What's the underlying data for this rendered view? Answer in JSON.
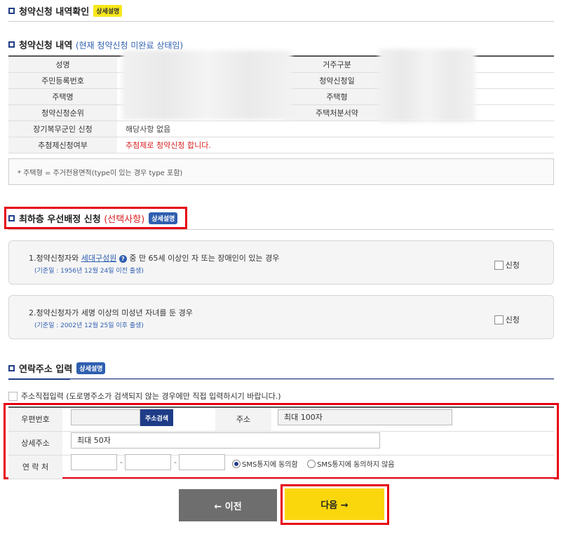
{
  "section1": {
    "title": "청약신청 내역확인",
    "badge": "상세설명"
  },
  "section2": {
    "title": "청약신청 내역",
    "sub": "(현재 청약신청 미완료 상태임)"
  },
  "info_table": {
    "rows": [
      {
        "label": "성명",
        "label2": "거주구분"
      },
      {
        "label": "주민등록번호",
        "label2": "청약신청일"
      },
      {
        "label": "주택명",
        "label2": "주택형"
      },
      {
        "label": "청약신청순위",
        "label2": "주택처분서약"
      },
      {
        "label": "장기복무군인 신청",
        "value": "해당사항 없음"
      },
      {
        "label": "추첨제신청여부",
        "value": "추첨제로 청약신청 합니다."
      }
    ]
  },
  "note": "* 주택형 = 주거전용면적(type이 있는 경우 type 포함)",
  "section3": {
    "title": "최하층 우선배정 신청",
    "sub": "(선택사항)",
    "badge": "상세설명"
  },
  "conditions": [
    {
      "title_pre": "1.청약신청자와",
      "link": "세대구성원",
      "help": "?",
      "title_post": "중 만 65세 이상인 자 또는 장애인이 있는 경우",
      "date": "(기준일 : 1956년 12월 24일 이전 출생)",
      "checkbox": "신청"
    },
    {
      "title_pre": "2.청약신청자가 세명 이상의 미성년 자녀를 둔 경우",
      "date": "(기준일 : 2002년 12월 25일 이후 출생)",
      "checkbox": "신청"
    }
  ],
  "section4": {
    "title": "연락주소 입력",
    "badge": "상세설명"
  },
  "direct_input": "주소직접입력 (도로명주소가 검색되지 않는 경우에만 직접 입력하시기 바랍니다.)",
  "address": {
    "zip_label": "우편번호",
    "search_btn": "주소검색",
    "addr_label": "주소",
    "addr_placeholder": "최대 100자",
    "detail_label": "상세주소",
    "detail_placeholder": "최대 50자",
    "contact_label": "연 락 처",
    "dash": "-",
    "sms_agree": "SMS통지에 동의함",
    "sms_disagree": "SMS통지에 동의하지 않음"
  },
  "buttons": {
    "prev": "← 이전",
    "next": "다음 →"
  }
}
